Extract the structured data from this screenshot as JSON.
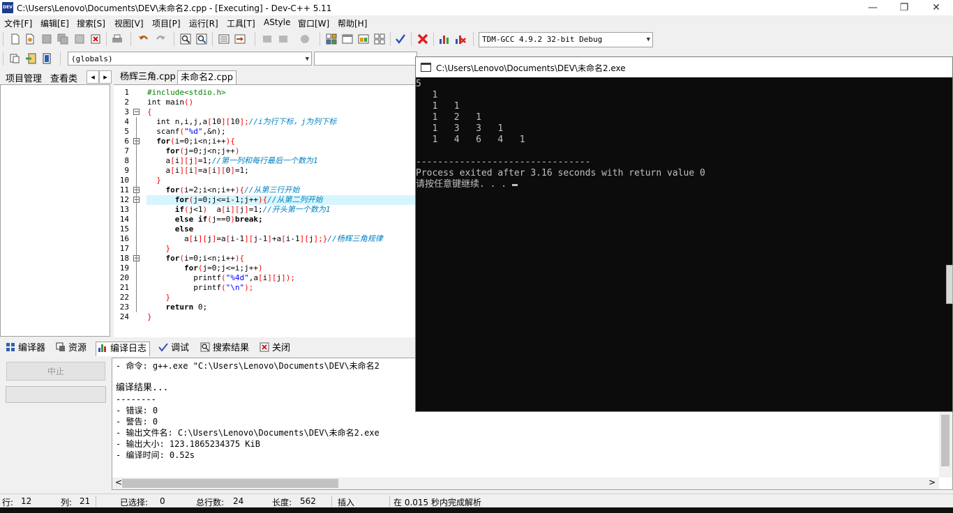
{
  "window": {
    "title": "C:\\Users\\Lenovo\\Documents\\DEV\\未命名2.cpp - [Executing] - Dev-C++ 5.11",
    "app_icon": "DEV",
    "buttons": {
      "minimize": "—",
      "restore": "❐",
      "close": "✕"
    }
  },
  "menu": [
    "文件[F]",
    "编辑[E]",
    "搜索[S]",
    "视图[V]",
    "项目[P]",
    "运行[R]",
    "工具[T]",
    "AStyle",
    "窗口[W]",
    "帮助[H]"
  ],
  "toolbar": {
    "compiler_select": "TDM-GCC 4.9.2 32-bit Debug",
    "scope_select": "(globals)"
  },
  "left_panel": {
    "tabs": [
      "项目管理",
      "查看类"
    ],
    "nav_prev": "◂",
    "nav_next": "▸"
  },
  "editor": {
    "tabs": [
      "杨辉三角.cpp",
      "未命名2.cpp"
    ],
    "active_tab": 1,
    "highlight_line": 12,
    "line_numbers": [
      "1",
      "2",
      "3",
      "4",
      "5",
      "6",
      "7",
      "8",
      "9",
      "10",
      "11",
      "12",
      "13",
      "14",
      "15",
      "16",
      "17",
      "18",
      "19",
      "20",
      "21",
      "22",
      "23",
      "24"
    ]
  },
  "code_lines": [
    [
      {
        "t": "#include<stdio.h>",
        "c": "#008000"
      }
    ],
    [
      {
        "t": "int main",
        "c": "#000"
      },
      {
        "t": "()",
        "c": "#ff0000"
      }
    ],
    [
      {
        "t": "{",
        "c": "#ff0000"
      }
    ],
    [
      {
        "t": "  int n,i,j,a",
        "c": "#000"
      },
      {
        "t": "[",
        "c": "#ff0000"
      },
      {
        "t": "10",
        "c": "#000"
      },
      {
        "t": "][",
        "c": "#ff0000"
      },
      {
        "t": "10",
        "c": "#000"
      },
      {
        "t": "];",
        "c": "#ff0000"
      },
      {
        "t": "//i为行下标，j为列下标",
        "c": "#0080c0",
        "i": true
      }
    ],
    [
      {
        "t": "  scanf",
        "c": "#000"
      },
      {
        "t": "(",
        "c": "#ff0000"
      },
      {
        "t": "\"%d\"",
        "c": "#0000ff"
      },
      {
        "t": ",&n);",
        "c": "#000"
      }
    ],
    [
      {
        "t": "  for",
        "c": "#000",
        "b": true
      },
      {
        "t": "(",
        "c": "#ff0000"
      },
      {
        "t": "i=0;i<n;i++",
        "c": "#000"
      },
      {
        "t": "){",
        "c": "#ff0000"
      }
    ],
    [
      {
        "t": "    for",
        "c": "#000",
        "b": true
      },
      {
        "t": "(",
        "c": "#ff0000"
      },
      {
        "t": "j=0;j<n;j++",
        "c": "#000"
      },
      {
        "t": ")",
        "c": "#ff0000"
      }
    ],
    [
      {
        "t": "    a",
        "c": "#000"
      },
      {
        "t": "[",
        "c": "#ff0000"
      },
      {
        "t": "i",
        "c": "#000"
      },
      {
        "t": "][",
        "c": "#ff0000"
      },
      {
        "t": "j",
        "c": "#000"
      },
      {
        "t": "]",
        "c": "#ff0000"
      },
      {
        "t": "=1;",
        "c": "#000"
      },
      {
        "t": "//第一列和每行最后一个数为1",
        "c": "#0080c0",
        "i": true
      }
    ],
    [
      {
        "t": "    a",
        "c": "#000"
      },
      {
        "t": "[",
        "c": "#ff0000"
      },
      {
        "t": "i",
        "c": "#000"
      },
      {
        "t": "][",
        "c": "#ff0000"
      },
      {
        "t": "i",
        "c": "#000"
      },
      {
        "t": "]",
        "c": "#ff0000"
      },
      {
        "t": "=a",
        "c": "#000"
      },
      {
        "t": "[",
        "c": "#ff0000"
      },
      {
        "t": "i",
        "c": "#000"
      },
      {
        "t": "][",
        "c": "#ff0000"
      },
      {
        "t": "0",
        "c": "#000"
      },
      {
        "t": "]",
        "c": "#ff0000"
      },
      {
        "t": "=1;",
        "c": "#000"
      }
    ],
    [
      {
        "t": "  }",
        "c": "#ff0000"
      }
    ],
    [
      {
        "t": "    for",
        "c": "#000",
        "b": true
      },
      {
        "t": "(",
        "c": "#ff0000"
      },
      {
        "t": "i=2;i<n;i++",
        "c": "#000"
      },
      {
        "t": "){",
        "c": "#ff0000"
      },
      {
        "t": "//从第三行开始",
        "c": "#0080c0",
        "i": true
      }
    ],
    [
      {
        "t": "      for",
        "c": "#000",
        "b": true
      },
      {
        "t": "(",
        "c": "#ff0000"
      },
      {
        "t": "j=0;j<=i-1;j++",
        "c": "#000"
      },
      {
        "t": "){",
        "c": "#ff0000"
      },
      {
        "t": "//从第二列开始",
        "c": "#0080c0",
        "i": true
      }
    ],
    [
      {
        "t": "      if",
        "c": "#000",
        "b": true
      },
      {
        "t": "(",
        "c": "#ff0000"
      },
      {
        "t": "j<1",
        "c": "#000"
      },
      {
        "t": ")",
        "c": "#ff0000"
      },
      {
        "t": "  a",
        "c": "#000"
      },
      {
        "t": "[",
        "c": "#ff0000"
      },
      {
        "t": "i",
        "c": "#000"
      },
      {
        "t": "][",
        "c": "#ff0000"
      },
      {
        "t": "j",
        "c": "#000"
      },
      {
        "t": "]",
        "c": "#ff0000"
      },
      {
        "t": "=1;",
        "c": "#000"
      },
      {
        "t": "//开头第一个数为1",
        "c": "#0080c0",
        "i": true
      }
    ],
    [
      {
        "t": "      else if",
        "c": "#000",
        "b": true
      },
      {
        "t": "(",
        "c": "#ff0000"
      },
      {
        "t": "j==0",
        "c": "#000"
      },
      {
        "t": ")",
        "c": "#ff0000"
      },
      {
        "t": "break;",
        "c": "#000",
        "b": true
      }
    ],
    [
      {
        "t": "      else",
        "c": "#000",
        "b": true
      }
    ],
    [
      {
        "t": "        a",
        "c": "#000"
      },
      {
        "t": "[",
        "c": "#ff0000"
      },
      {
        "t": "i",
        "c": "#000"
      },
      {
        "t": "][",
        "c": "#ff0000"
      },
      {
        "t": "j",
        "c": "#000"
      },
      {
        "t": "]",
        "c": "#ff0000"
      },
      {
        "t": "=a",
        "c": "#000"
      },
      {
        "t": "[",
        "c": "#ff0000"
      },
      {
        "t": "i-1",
        "c": "#000"
      },
      {
        "t": "][",
        "c": "#ff0000"
      },
      {
        "t": "j-1",
        "c": "#000"
      },
      {
        "t": "]",
        "c": "#ff0000"
      },
      {
        "t": "+a",
        "c": "#000"
      },
      {
        "t": "[",
        "c": "#ff0000"
      },
      {
        "t": "i-1",
        "c": "#000"
      },
      {
        "t": "][",
        "c": "#ff0000"
      },
      {
        "t": "j",
        "c": "#000"
      },
      {
        "t": "];}",
        "c": "#ff0000"
      },
      {
        "t": "//杨辉三角规律",
        "c": "#0080c0",
        "i": true
      }
    ],
    [
      {
        "t": "    }",
        "c": "#ff0000"
      }
    ],
    [
      {
        "t": "    for",
        "c": "#000",
        "b": true
      },
      {
        "t": "(",
        "c": "#ff0000"
      },
      {
        "t": "i=0;i<n;i++",
        "c": "#000"
      },
      {
        "t": "){",
        "c": "#ff0000"
      }
    ],
    [
      {
        "t": "        for",
        "c": "#000",
        "b": true
      },
      {
        "t": "(",
        "c": "#ff0000"
      },
      {
        "t": "j=0;j<=i;j++",
        "c": "#000"
      },
      {
        "t": ")",
        "c": "#ff0000"
      }
    ],
    [
      {
        "t": "          printf",
        "c": "#000"
      },
      {
        "t": "(",
        "c": "#ff0000"
      },
      {
        "t": "\"%4d\"",
        "c": "#0000ff"
      },
      {
        "t": ",a",
        "c": "#000"
      },
      {
        "t": "[",
        "c": "#ff0000"
      },
      {
        "t": "i",
        "c": "#000"
      },
      {
        "t": "][",
        "c": "#ff0000"
      },
      {
        "t": "j",
        "c": "#000"
      },
      {
        "t": "]);",
        "c": "#ff0000"
      }
    ],
    [
      {
        "t": "          printf",
        "c": "#000"
      },
      {
        "t": "(",
        "c": "#ff0000"
      },
      {
        "t": "\"\\n\"",
        "c": "#0000ff"
      },
      {
        "t": ");",
        "c": "#ff0000"
      }
    ],
    [
      {
        "t": "    }",
        "c": "#ff0000"
      }
    ],
    [
      {
        "t": "    return ",
        "c": "#000",
        "b": true
      },
      {
        "t": "0",
        "c": "#000"
      },
      {
        "t": ";",
        "c": "#000"
      }
    ],
    [
      {
        "t": "}",
        "c": "#ff0000"
      }
    ]
  ],
  "bottom_panel": {
    "tabs": [
      "编译器",
      "资源",
      "编译日志",
      "调试",
      "搜索结果",
      "关闭"
    ],
    "active_tab": 2,
    "abort_button": "中止",
    "log_lines": [
      "- 命令: g++.exe \"C:\\Users\\Lenovo\\Documents\\DEV\\未命名2",
      "",
      "编译结果...",
      "--------",
      "- 错误: 0",
      "- 警告: 0",
      "- 输出文件名: C:\\Users\\Lenovo\\Documents\\DEV\\未命名2.exe",
      "- 输出大小: 123.1865234375 KiB",
      "- 编译时间: 0.52s"
    ],
    "scroll_left": "<",
    "scroll_right": ">"
  },
  "status_bar": {
    "row_label": "行:",
    "row_value": "12",
    "col_label": "列:",
    "col_value": "21",
    "sel_label": "已选择:",
    "sel_value": "0",
    "total_label": "总行数:",
    "total_value": "24",
    "len_label": "长度:",
    "len_value": "562",
    "mode": "插入",
    "parse_msg": "在 0.015 秒内完成解析"
  },
  "console": {
    "title": "C:\\Users\\Lenovo\\Documents\\DEV\\未命名2.exe",
    "lines": [
      "5",
      "   1",
      "   1   1",
      "   1   2   1",
      "   1   3   3   1",
      "   1   4   6   4   1",
      "",
      "--------------------------------",
      "Process exited after 3.16 seconds with return value 0",
      "请按任意键继续. . . "
    ]
  }
}
